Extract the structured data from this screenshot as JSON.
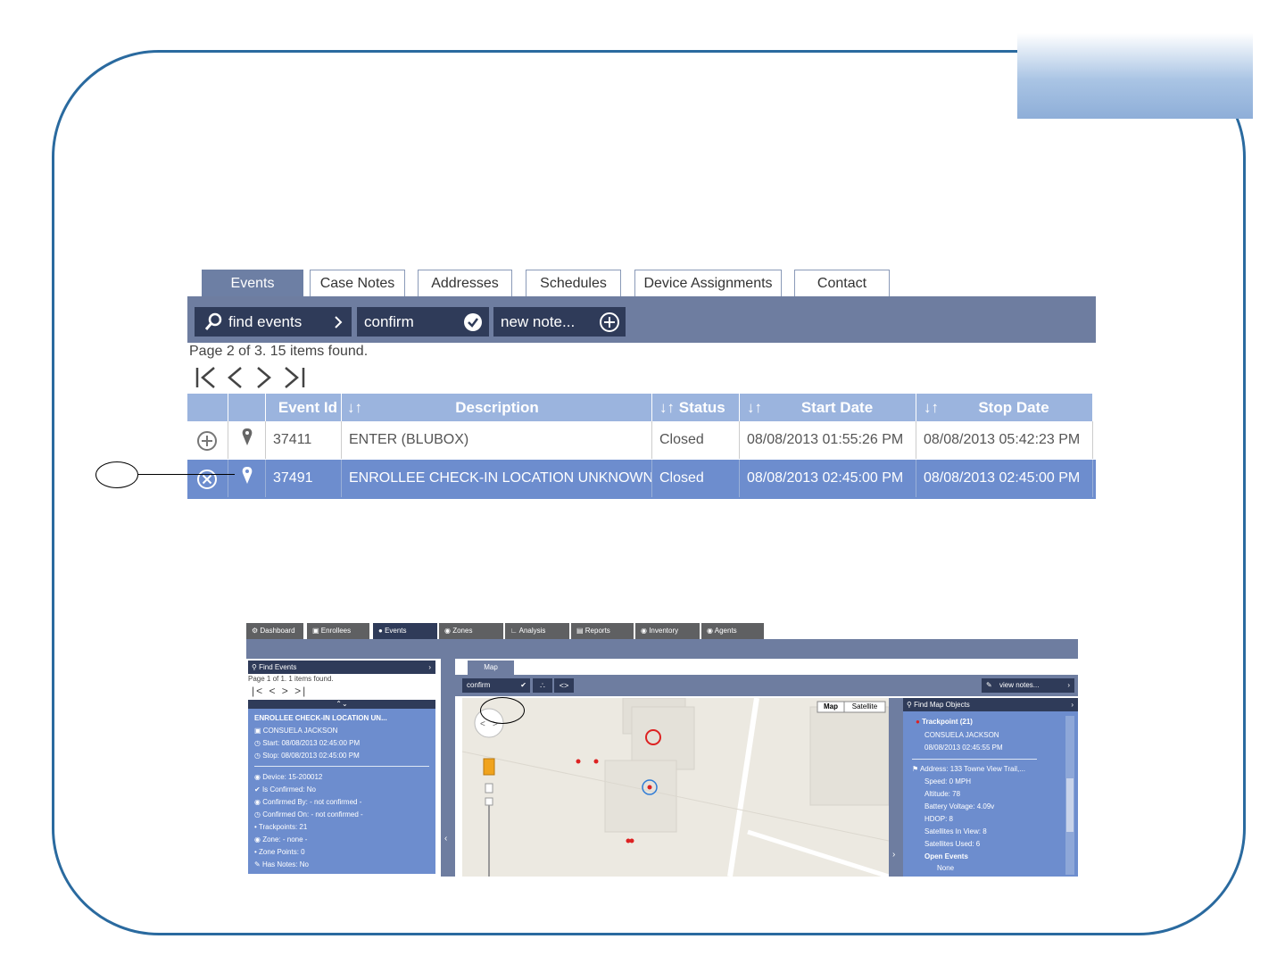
{
  "top_panel": {
    "tabs": [
      "Events",
      "Case Notes",
      "Addresses",
      "Schedules",
      "Device Assignments",
      "Contact"
    ],
    "toolbar": {
      "find_label": "find events",
      "confirm_label": "confirm",
      "note_label": "new note..."
    },
    "page_info": "Page 2 of 3. 15 items found.",
    "columns": {
      "event_id": "Event Id",
      "description": "Description",
      "status": "Status",
      "start": "Start Date",
      "stop": "Stop Date"
    },
    "rows": [
      {
        "id": "37411",
        "description": "ENTER (BLUBOX)",
        "status": "Closed",
        "start": "08/08/2013 01:55:26 PM",
        "stop": "08/08/2013 05:42:23 PM"
      },
      {
        "id": "37491",
        "description": "ENROLLEE CHECK-IN LOCATION UNKNOWN",
        "status": "Closed",
        "start": "08/08/2013 02:45:00 PM",
        "stop": "08/08/2013 02:45:00 PM"
      }
    ]
  },
  "bottom_screenshot": {
    "nav_tabs": [
      "Dashboard",
      "Enrollees",
      "Events",
      "Zones",
      "Analysis",
      "Reports",
      "Inventory",
      "Agents"
    ],
    "left_panel": {
      "header": "Find Events",
      "page_info": "Page 1 of 1. 1 items found.",
      "title": "ENROLLEE CHECK-IN LOCATION UN...",
      "enrollee": "CONSUELA JACKSON",
      "start": "Start: 08/08/2013 02:45:00 PM",
      "stop": "Stop: 08/08/2013 02:45:00 PM",
      "device": "Device: 15-200012",
      "is_confirmed": "Is Confirmed: No",
      "confirmed_by": "Confirmed By: - not confirmed -",
      "confirmed_on": "Confirmed On: - not confirmed -",
      "trackpoints": "Trackpoints: 21",
      "zone": "Zone: - none -",
      "zone_points": "Zone Points: 0",
      "has_notes": "Has Notes: No"
    },
    "map_tab": "Map",
    "map_toolbar": {
      "confirm": "confirm",
      "view_notes": "view notes..."
    },
    "map_type": {
      "map": "Map",
      "satellite": "Satellite"
    },
    "right_panel": {
      "header": "Find Map Objects",
      "trackpoint": "Trackpoint (21)",
      "name": "CONSUELA JACKSON",
      "time": "08/08/2013 02:45:55 PM",
      "address": "Address: 133 Towne View Trail,...",
      "speed": "Speed: 0 MPH",
      "altitude": "Altitude: 78",
      "battery": "Battery Voltage: 4.09v",
      "hdop": "HDOP: 8",
      "sat_view": "Satellites In View: 8",
      "sat_used": "Satellites Used: 6",
      "open_events": "Open Events",
      "none": "None"
    }
  },
  "colors": {
    "frame": "#2a6a9f",
    "toolbar": "#6e7da0",
    "button": "#2f3b59",
    "header": "#9bb4de",
    "selected_row": "#6d8dce"
  }
}
